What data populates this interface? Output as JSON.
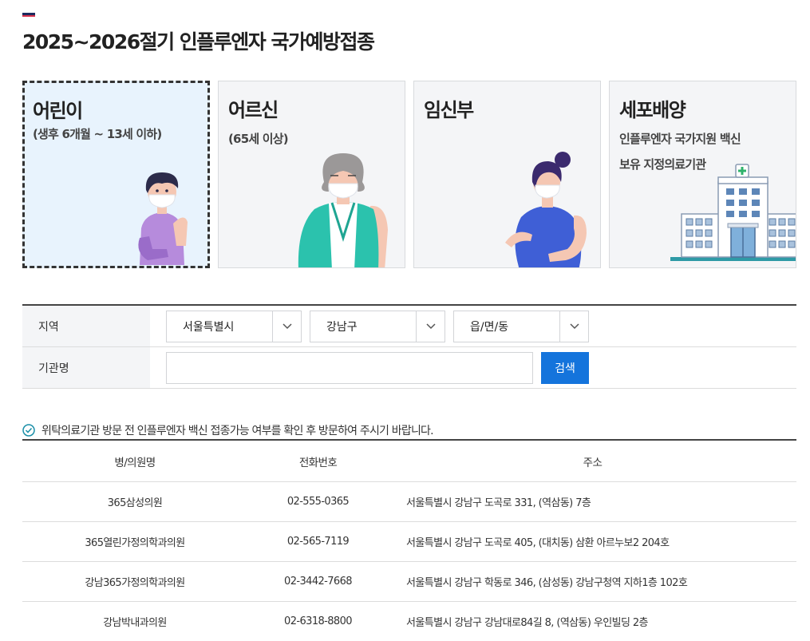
{
  "page": {
    "title": "2025~2026절기 인플루엔자 국가예방접종"
  },
  "cards": [
    {
      "title": "어린이",
      "subtitle": "(생후 6개월 ~ 13세 이하)",
      "subtitle2": "",
      "selected": true,
      "icon": "child-icon"
    },
    {
      "title": "어르신",
      "subtitle": "(65세 이상)",
      "subtitle2": "",
      "selected": false,
      "icon": "elderly-icon"
    },
    {
      "title": "임신부",
      "subtitle": "",
      "subtitle2": "",
      "selected": false,
      "icon": "pregnant-woman-icon"
    },
    {
      "title": "세포배양",
      "subtitle": "인플루엔자 국가지원 백신",
      "subtitle2": "보유 지정의료기관",
      "selected": false,
      "icon": "hospital-icon"
    }
  ],
  "filter": {
    "region_label": "지역",
    "city": "서울특별시",
    "district": "강남구",
    "town": "읍/면/동",
    "name_label": "기관명",
    "name_value": "",
    "search_label": "검색"
  },
  "notice": "위탁의료기관 방문 전 인플루엔자 백신 접종가능 여부를 확인 후 방문하여 주시기 바랍니다.",
  "table": {
    "headers": [
      "병/의원명",
      "전화번호",
      "주소"
    ],
    "rows": [
      {
        "name": "365삼성의원",
        "tel": "02-555-0365",
        "addr": "서울특별시 강남구 도곡로 331, (역삼동) 7층"
      },
      {
        "name": "365열린가정의학과의원",
        "tel": "02-565-7119",
        "addr": "서울특별시 강남구 도곡로 405, (대치동) 삼환 아르누보2 204호"
      },
      {
        "name": "강남365가정의학과의원",
        "tel": "02-3442-7668",
        "addr": "서울특별시 강남구 학동로 346, (삼성동) 강남구청역 지하1층 102호"
      },
      {
        "name": "강남박내과의원",
        "tel": "02-6318-8800",
        "addr": "서울특별시 강남구 강남대로84길 8, (역삼동) 우인빌딩 2층"
      }
    ]
  },
  "colors": {
    "accent": "#1474dc",
    "active_card_bg": "#e8f3fd",
    "card_bg": "#f4f5f7"
  }
}
